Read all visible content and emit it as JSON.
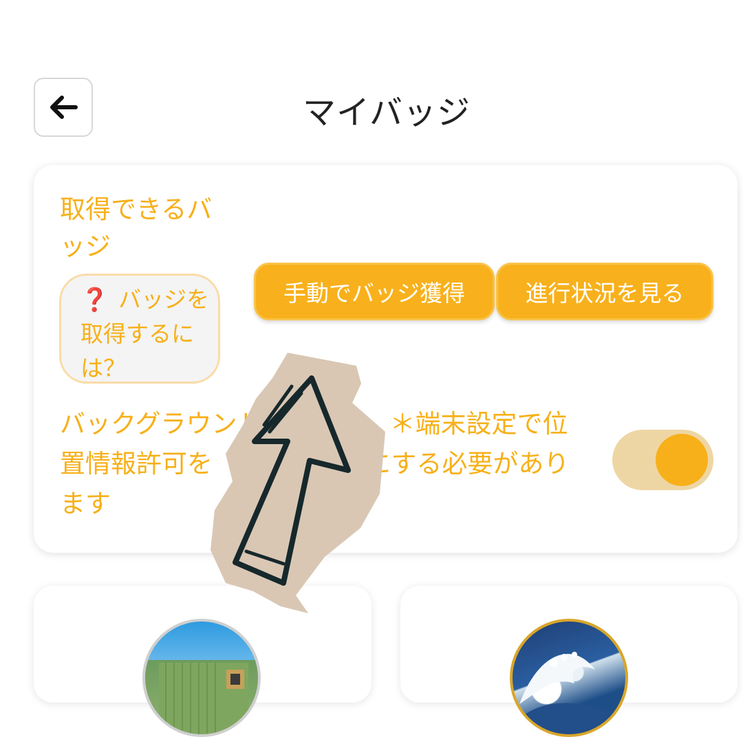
{
  "header": {
    "title": "マイバッジ"
  },
  "card": {
    "title": "取得できるバッジ",
    "help": {
      "mark": "❓",
      "text": "バッジを取得するには？"
    },
    "manual_button_label": "手動でバッジ獲得",
    "progress_button_label": "進行状況を見る",
    "background_text": "バックグラウンド　　　　　＊端末設定で位置情報許可を「常に許可」にする必要があります",
    "toggle_on": true
  },
  "colors": {
    "accent": "#F7B019",
    "toggle_track": "#EED6A4",
    "help_mark": "#D9232A"
  },
  "icons": {
    "back": "arrow-left-icon"
  }
}
